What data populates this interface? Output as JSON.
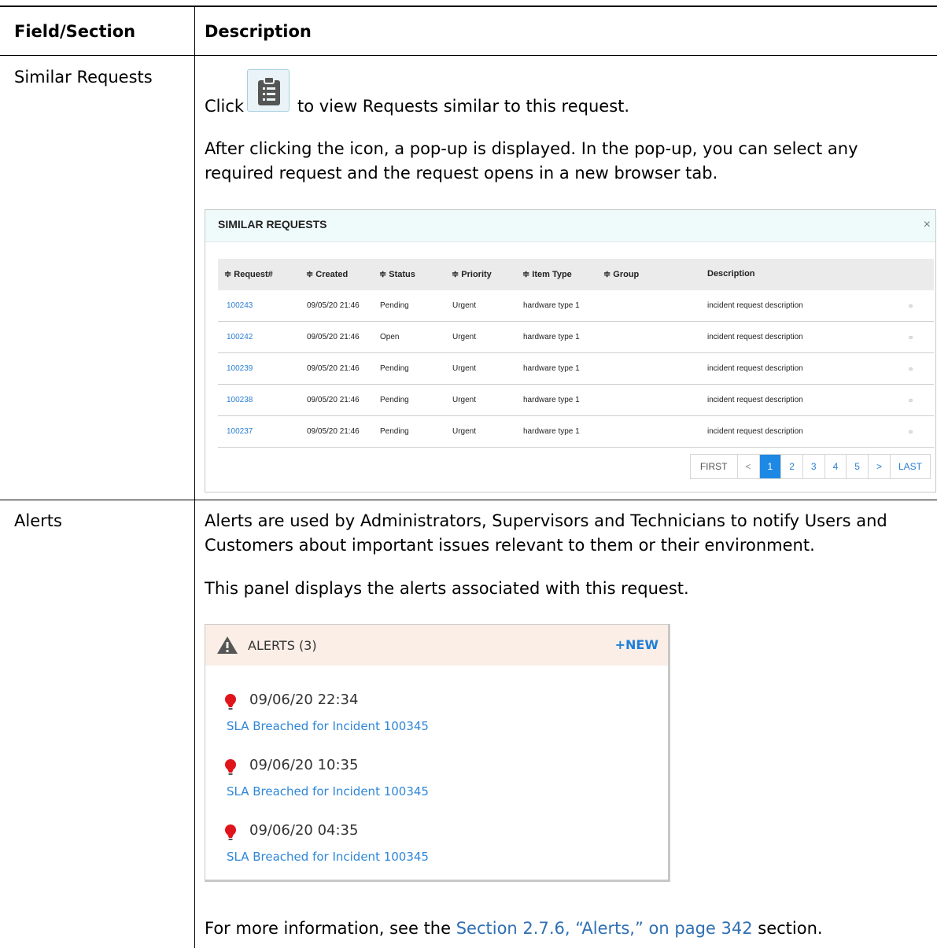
{
  "table": {
    "col1_header": "Field/Section",
    "col2_header": "Description"
  },
  "similar_requests": {
    "field": "Similar Requests",
    "click_before": "Click",
    "click_after": "to view Requests similar to this request.",
    "icon": "clipboard-icon",
    "para2": "After clicking the icon, a pop-up is displayed. In the pop-up, you can select any required request and the request opens in a new browser tab.",
    "panel": {
      "title": "SIMILAR REQUESTS",
      "close": "×",
      "columns": [
        "≑ Request#",
        "≑ Created",
        "≑ Status",
        "≑ Priority",
        "≑ Item Type",
        "≑ Group",
        "Description"
      ],
      "rows": [
        {
          "req": "100243",
          "created": "09/05/20 21:46",
          "status": "Pending",
          "priority": "Urgent",
          "item_type": "hardware type 1",
          "group": "",
          "description": "incident request description"
        },
        {
          "req": "100242",
          "created": "09/05/20 21:46",
          "status": "Open",
          "priority": "Urgent",
          "item_type": "hardware type 1",
          "group": "",
          "description": "incident request description"
        },
        {
          "req": "100239",
          "created": "09/05/20 21:46",
          "status": "Pending",
          "priority": "Urgent",
          "item_type": "hardware type 1",
          "group": "",
          "description": "incident request description"
        },
        {
          "req": "100238",
          "created": "09/05/20 21:46",
          "status": "Pending",
          "priority": "Urgent",
          "item_type": "hardware type 1",
          "group": "",
          "description": "incident request description"
        },
        {
          "req": "100237",
          "created": "09/05/20 21:46",
          "status": "Pending",
          "priority": "Urgent",
          "item_type": "hardware type 1",
          "group": "",
          "description": "incident request description"
        }
      ],
      "row_icon": "link-icon",
      "pager": {
        "first": "FIRST",
        "prev": "<",
        "pages": [
          "1",
          "2",
          "3",
          "4",
          "5"
        ],
        "active": "1",
        "next": ">",
        "last": "LAST"
      }
    }
  },
  "alerts": {
    "field": "Alerts",
    "para1": "Alerts are used by Administrators, Supervisors and Technicians to notify Users and Customers about important issues relevant to them or their environment.",
    "para2": "This panel displays the alerts associated with this request.",
    "panel": {
      "icon": "warning-icon",
      "title": "ALERTS (3)",
      "new_label": "+NEW",
      "items": [
        {
          "date": "09/06/20 22:34",
          "message": "SLA Breached for Incident 100345"
        },
        {
          "date": "09/06/20 10:35",
          "message": "SLA Breached for Incident 100345"
        },
        {
          "date": "09/06/20 04:35",
          "message": "SLA Breached for Incident 100345"
        }
      ],
      "item_icon": "lightbulb-icon"
    },
    "footer_before": "For more information, see the ",
    "footer_link": "Section 2.7.6, “Alerts,” on page 342",
    "footer_after": " section."
  },
  "colors": {
    "link": "#2f6fb3",
    "accent": "#1e88e5",
    "alert_header": "#fbeee6",
    "panel_header": "#effbfb"
  }
}
